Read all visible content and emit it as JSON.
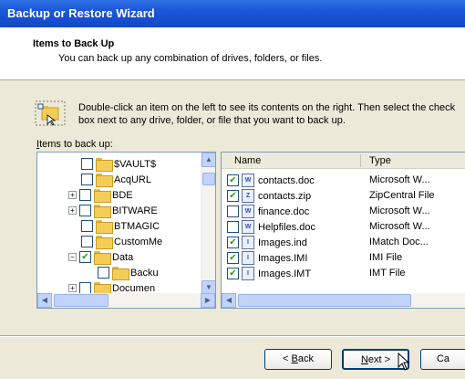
{
  "window": {
    "title": "Backup or Restore Wizard"
  },
  "header": {
    "title": "Items to Back Up",
    "subtitle": "You can back up any combination of drives, folders, or files."
  },
  "instruction": "Double-click an item on the left to see its contents on the right. Then select the check box next to any drive, folder, or file that you want to back up.",
  "items_label": {
    "prefix": "I",
    "rest": "tems to back up:"
  },
  "tree": {
    "items": [
      {
        "label": "$VAULT$",
        "checked": false,
        "expander": ""
      },
      {
        "label": "AcqURL",
        "checked": false,
        "expander": ""
      },
      {
        "label": "BDE",
        "checked": false,
        "expander": "+"
      },
      {
        "label": "BITWARE",
        "checked": false,
        "expander": "+"
      },
      {
        "label": "BTMAGIC",
        "checked": false,
        "expander": ""
      },
      {
        "label": "CustomMe",
        "checked": false,
        "expander": ""
      },
      {
        "label": "Data",
        "checked": true,
        "expander": "−"
      },
      {
        "label": "Backu",
        "checked": false,
        "expander": ""
      },
      {
        "label": "Documen",
        "checked": false,
        "expander": "+"
      }
    ]
  },
  "list": {
    "columns": {
      "name": "Name",
      "type": "Type"
    },
    "rows": [
      {
        "name": "contacts.doc",
        "type": "Microsoft W...",
        "checked": true,
        "icon": "W"
      },
      {
        "name": "contacts.zip",
        "type": "ZipCentral File",
        "checked": true,
        "icon": "Z"
      },
      {
        "name": "finance.doc",
        "type": "Microsoft W...",
        "checked": false,
        "icon": "W"
      },
      {
        "name": "Helpfiles.doc",
        "type": "Microsoft W...",
        "checked": false,
        "icon": "W"
      },
      {
        "name": "Images.ind",
        "type": "IMatch Doc...",
        "checked": true,
        "icon": "I"
      },
      {
        "name": "Images.IMI",
        "type": "IMI File",
        "checked": true,
        "icon": "I"
      },
      {
        "name": "Images.IMT",
        "type": "IMT File",
        "checked": true,
        "icon": "I"
      }
    ]
  },
  "buttons": {
    "back": {
      "prefix": "< ",
      "accel": "B",
      "rest": "ack"
    },
    "next": {
      "accel": "N",
      "rest": "ext >"
    },
    "cancel": "Ca"
  },
  "colors": {
    "accent": "#1a56d8",
    "face": "#ece9d8",
    "check": "#21a121"
  }
}
